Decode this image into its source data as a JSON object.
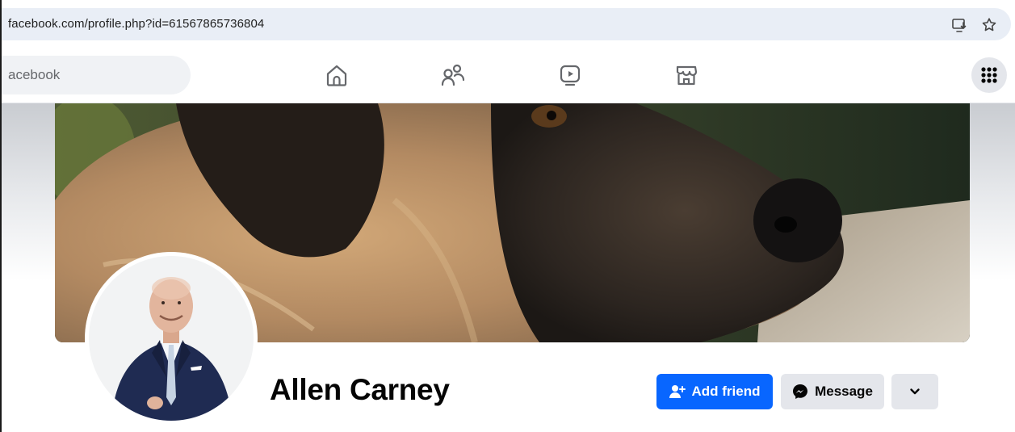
{
  "browser": {
    "url": "facebook.com/profile.php?id=61567865736804",
    "icons": [
      "install-app-icon",
      "bookmark-star-icon"
    ]
  },
  "nav": {
    "search_placeholder": "acebook",
    "icons": [
      "home-icon",
      "friends-icon",
      "watch-icon",
      "marketplace-icon",
      "menu-grid-icon"
    ]
  },
  "profile": {
    "name": "Allen Carney",
    "add_friend_label": "Add friend",
    "message_label": "Message"
  },
  "colors": {
    "primary_button": "#0866ff",
    "secondary_button": "#e4e6eb",
    "address_bar": "#e9eef6"
  }
}
